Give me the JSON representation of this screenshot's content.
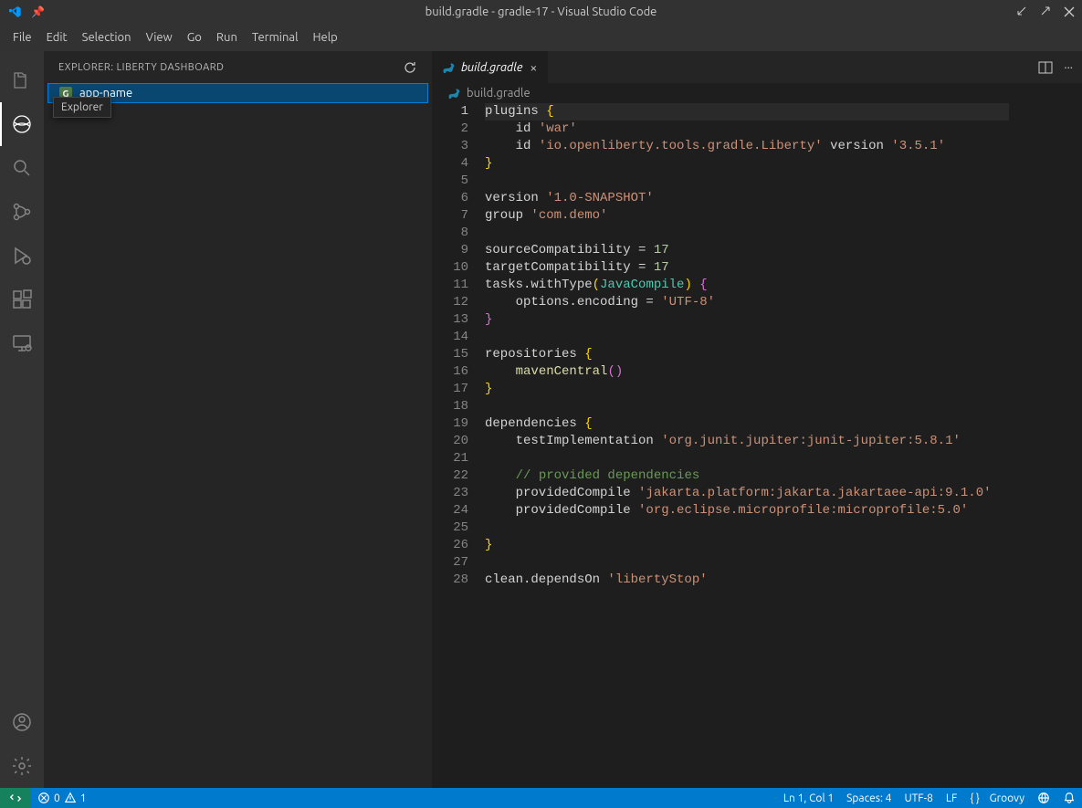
{
  "window": {
    "title": "build.gradle - gradle-17 - Visual Studio Code"
  },
  "menu": [
    "File",
    "Edit",
    "Selection",
    "View",
    "Go",
    "Run",
    "Terminal",
    "Help"
  ],
  "sidebar": {
    "title": "EXPLORER: LIBERTY DASHBOARD",
    "item_badge": "G",
    "item_label": "app-name",
    "tooltip": "Explorer"
  },
  "tab": {
    "label": "build.gradle"
  },
  "breadcrumb": {
    "label": "build.gradle"
  },
  "editor": {
    "line_count": 28,
    "current_line": 1
  },
  "code_tokens": [
    [
      [
        "ident",
        "plugins"
      ],
      [
        "kw",
        " "
      ],
      [
        "pun",
        "{"
      ]
    ],
    [
      [
        "kw",
        "    id "
      ],
      [
        "str",
        "'war'"
      ]
    ],
    [
      [
        "kw",
        "    id "
      ],
      [
        "str",
        "'io.openliberty.tools.gradle.Liberty'"
      ],
      [
        "kw",
        " version "
      ],
      [
        "str",
        "'3.5.1'"
      ]
    ],
    [
      [
        "pun",
        "}"
      ]
    ],
    [],
    [
      [
        "ident",
        "version "
      ],
      [
        "str",
        "'1.0-SNAPSHOT'"
      ]
    ],
    [
      [
        "ident",
        "group "
      ],
      [
        "str",
        "'com.demo'"
      ]
    ],
    [],
    [
      [
        "ident",
        "sourceCompatibility = "
      ],
      [
        "num",
        "17"
      ]
    ],
    [
      [
        "ident",
        "targetCompatibility = "
      ],
      [
        "num",
        "17"
      ]
    ],
    [
      [
        "ident",
        "tasks.withType"
      ],
      [
        "pun",
        "("
      ],
      [
        "cls",
        "JavaCompile"
      ],
      [
        "pun",
        ")"
      ],
      [
        "kw",
        " "
      ],
      [
        "pun2",
        "{"
      ]
    ],
    [
      [
        "ident",
        "    options.encoding = "
      ],
      [
        "str",
        "'UTF-8'"
      ]
    ],
    [
      [
        "pun2",
        "}"
      ]
    ],
    [],
    [
      [
        "ident",
        "repositories "
      ],
      [
        "pun",
        "{"
      ]
    ],
    [
      [
        "kw",
        "    "
      ],
      [
        "fn",
        "mavenCentral"
      ],
      [
        "pun2",
        "()"
      ]
    ],
    [
      [
        "pun",
        "}"
      ]
    ],
    [],
    [
      [
        "ident",
        "dependencies "
      ],
      [
        "pun",
        "{"
      ]
    ],
    [
      [
        "kw",
        "    testImplementation "
      ],
      [
        "str",
        "'org.junit.jupiter:junit-jupiter:5.8.1'"
      ]
    ],
    [],
    [
      [
        "kw",
        "    "
      ],
      [
        "cmt",
        "// provided dependencies"
      ]
    ],
    [
      [
        "kw",
        "    providedCompile "
      ],
      [
        "str",
        "'jakarta.platform:jakarta.jakartaee-api:9.1.0'"
      ]
    ],
    [
      [
        "kw",
        "    providedCompile "
      ],
      [
        "str",
        "'org.eclipse.microprofile:microprofile:5.0'"
      ]
    ],
    [],
    [
      [
        "pun",
        "}"
      ]
    ],
    [],
    [
      [
        "ident",
        "clean.dependsOn "
      ],
      [
        "str",
        "'libertyStop'"
      ]
    ]
  ],
  "status": {
    "errors": "0",
    "warnings": "1",
    "cursor": "Ln 1, Col 1",
    "spaces": "Spaces: 4",
    "encoding": "UTF-8",
    "eol": "LF",
    "language": "Groovy"
  }
}
